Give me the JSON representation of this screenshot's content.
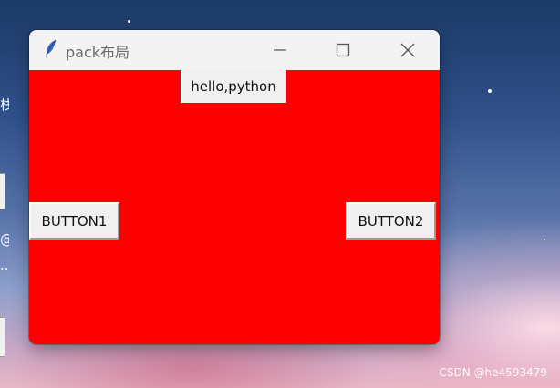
{
  "desktop": {
    "left_glyphs": [
      "栈",
      "@",
      "..."
    ]
  },
  "window": {
    "title": "pack布局",
    "app_icon": "feather-icon",
    "controls": {
      "minimize_icon": "minimize-icon",
      "maximize_icon": "maximize-icon",
      "close_icon": "close-icon"
    },
    "background_color": "#ff0000"
  },
  "content": {
    "label_text": "hello,python",
    "button1_label": "BUTTON1",
    "button2_label": "BUTTON2"
  },
  "watermark": "CSDN @he4593479"
}
